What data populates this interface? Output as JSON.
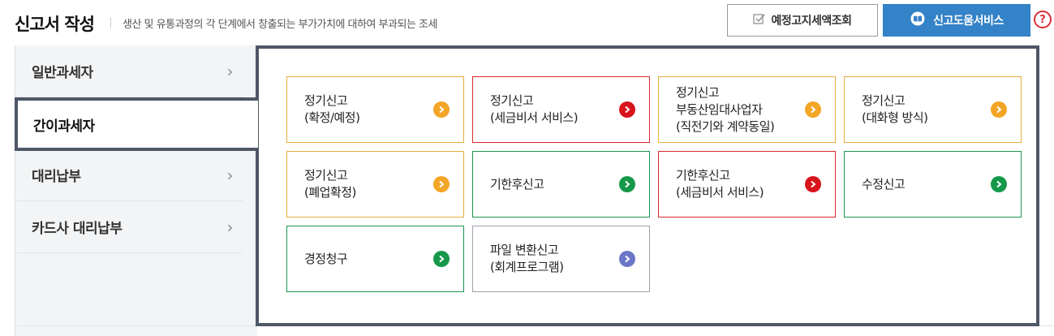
{
  "header": {
    "title": "신고서 작성",
    "subtitle": "생산 및 유통과정의 각 단계에서 창출되는 부가가치에 대하여 부과되는 조세",
    "prenotice_button": "예정고지세액조회",
    "service_button": "신고도움서비스",
    "help_symbol": "?"
  },
  "sidebar": {
    "items": [
      {
        "label": "일반과세자",
        "active": false
      },
      {
        "label": "간이과세자",
        "active": true
      },
      {
        "label": "대리납부",
        "active": false
      },
      {
        "label": "카드사 대리납부",
        "active": false
      }
    ],
    "chevron": "›"
  },
  "cards": [
    {
      "label": "정기신고\n(확정/예정)",
      "border": "orange",
      "arrow": "orange"
    },
    {
      "label": "정기신고\n(세금비서 서비스)",
      "border": "red",
      "arrow": "red"
    },
    {
      "label": "정기신고\n부동산임대사업자\n(직전기와 계약동일)",
      "border": "orange",
      "arrow": "orange"
    },
    {
      "label": "정기신고\n(대화형 방식)",
      "border": "orange",
      "arrow": "orange"
    },
    {
      "label": "정기신고\n(폐업확정)",
      "border": "orange",
      "arrow": "orange"
    },
    {
      "label": "기한후신고",
      "border": "green",
      "arrow": "green"
    },
    {
      "label": "기한후신고\n(세금비서 서비스)",
      "border": "red",
      "arrow": "red"
    },
    {
      "label": "수정신고",
      "border": "green",
      "arrow": "green"
    },
    {
      "label": "경정청구",
      "border": "green",
      "arrow": "green"
    },
    {
      "label": "파일 변환신고\n(회계프로그램)",
      "border": "gray",
      "arrow": "purple"
    }
  ],
  "colors": {
    "orange": "#f3a526",
    "red": "#d8141c",
    "green": "#15984a",
    "purple": "#6b76c6",
    "service_blue": "#3482c8",
    "panel_border": "#4e5866"
  },
  "icons": {
    "prenotice": "checkbox-icon",
    "service": "book-icon",
    "help": "help-icon",
    "card_arrow": "chevron-right-icon"
  }
}
